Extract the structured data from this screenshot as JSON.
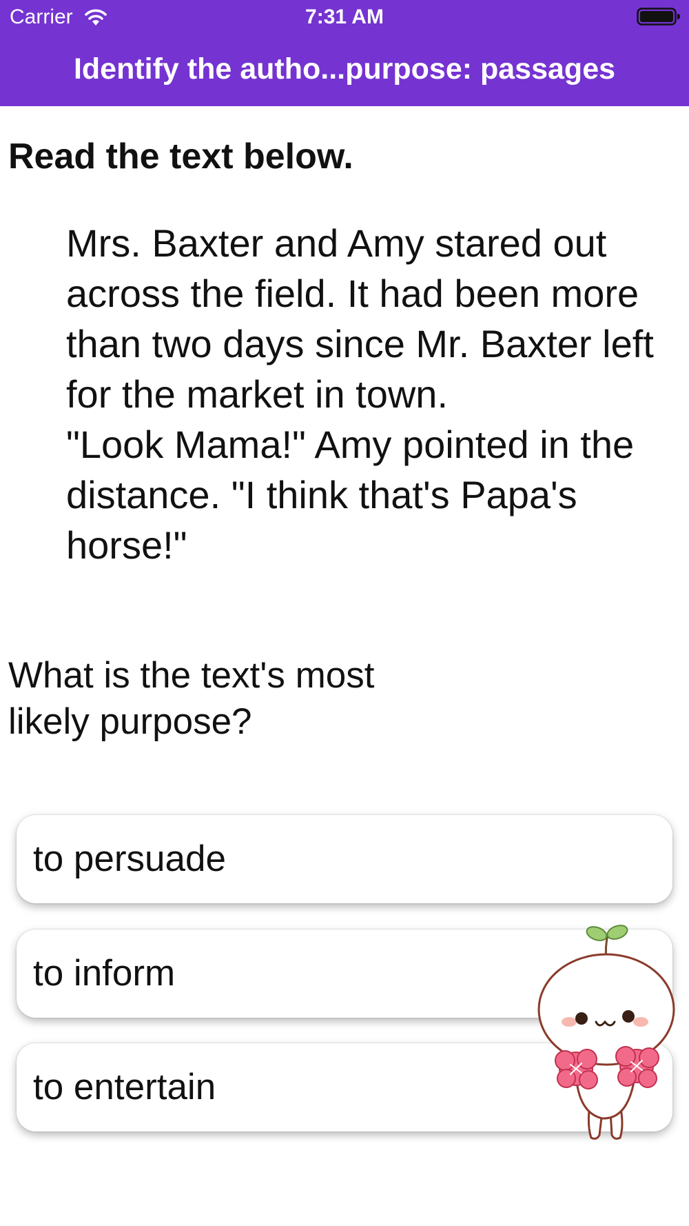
{
  "status_bar": {
    "carrier": "Carrier",
    "time": "7:31 AM",
    "wifi_icon": "wifi-icon",
    "battery_icon": "battery-full-icon"
  },
  "header": {
    "title": "Identify the autho...purpose: passages",
    "background_color": "#7533d1"
  },
  "content": {
    "instruction": "Read the text below.",
    "passage": [
      "Mrs. Baxter and Amy stared out across the field. It had been more than two days since Mr. Baxter left for the market in town.",
      "\"Look Mama!\" Amy pointed in the distance. \"I think that's Papa's horse!\""
    ],
    "question": "What is the text's most likely purpose?"
  },
  "choices": [
    {
      "label": "to persuade"
    },
    {
      "label": "to inform"
    },
    {
      "label": "to entertain"
    }
  ],
  "mascot": {
    "icon": "cheering-sprout-mascot"
  }
}
